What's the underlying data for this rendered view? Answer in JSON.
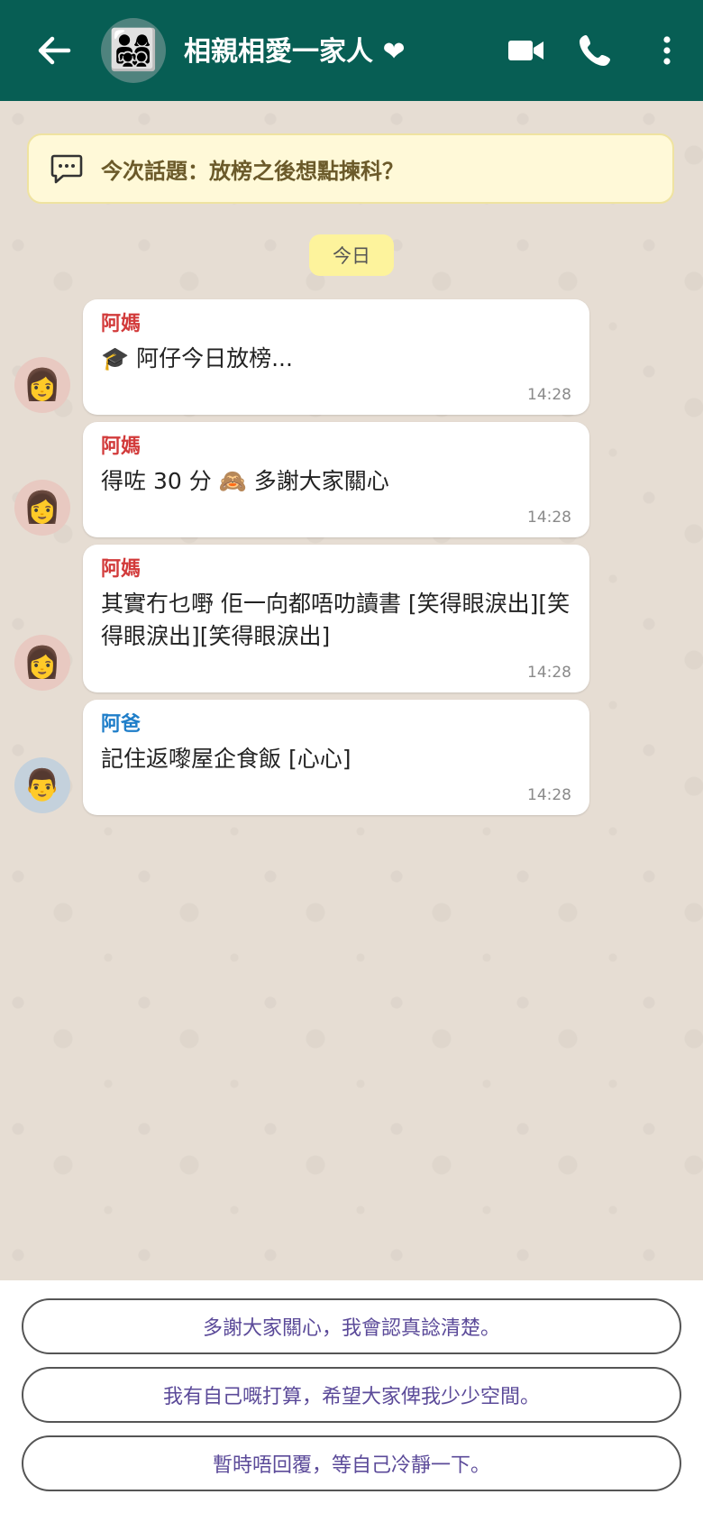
{
  "header": {
    "title": "相親相愛一家人 ❤",
    "group_avatar_emoji": "👨‍👩‍👧‍👦"
  },
  "topic_banner": {
    "text": "今次話題：放榜之後想點揀科？",
    "icon": "chat-bubble-icon"
  },
  "date_chip": "今日",
  "messages": [
    {
      "sender": "阿媽",
      "avatar": "👩",
      "text": "🎓 阿仔今日放榜...",
      "time": "14:28"
    },
    {
      "sender": "阿媽",
      "avatar": "👩",
      "text": "得咗 30 分 🙈 多謝大家關心",
      "time": "14:28"
    },
    {
      "sender": "阿媽",
      "avatar": "👩",
      "text": "其實冇乜嘢 佢一向都唔叻讀書 [笑得眼淚出][笑得眼淚出][笑得眼淚出]",
      "time": "14:28"
    },
    {
      "sender": "阿爸",
      "avatar": "👨",
      "text": "記住返嚟屋企食飯 [心心]",
      "time": "14:28"
    }
  ],
  "replies": [
    "多謝大家關心，我會認真諗清楚。",
    "我有自己嘅打算，希望大家俾我少少空間。",
    "暫時唔回覆，等自己冷靜一下。"
  ],
  "colors": {
    "header_bg": "#075e54",
    "chat_bg": "#e6ddd3",
    "mom_name": "#d23b3b",
    "dad_name": "#1f7ec9",
    "reply_text": "#5b4a99",
    "topic_bg": "#fff9d8",
    "date_chip_bg": "#fdf39c"
  }
}
